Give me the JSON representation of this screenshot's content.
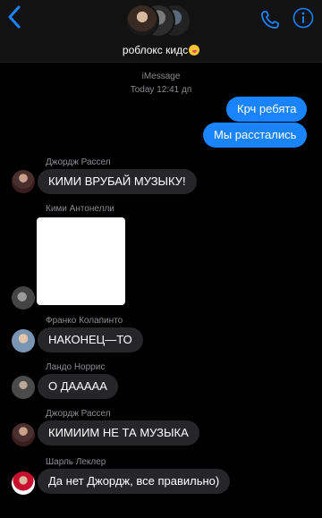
{
  "header": {
    "title": "роблокс кидс",
    "emoji": "grinning-tongue-emoji",
    "icons": [
      "chevron-left-icon",
      "phone-icon",
      "info-icon"
    ],
    "accent": "#1a84ff"
  },
  "thread": {
    "service": "iMessage",
    "timestamp": "Today 12:41 дп"
  },
  "messages": [
    {
      "direction": "out",
      "text": "Крч ребята"
    },
    {
      "direction": "out",
      "text": "Мы расстались"
    },
    {
      "direction": "in",
      "sender": "Джордж Рассел",
      "text": "КИМИ ВРУБАЙ МУЗЫКУ!"
    },
    {
      "direction": "in",
      "sender": "Кими Антонелли",
      "attachment": "image"
    },
    {
      "direction": "in",
      "sender": "Франко Колапинто",
      "text": "НАКОНЕЦ—ТО"
    },
    {
      "direction": "in",
      "sender": "Ландо Норрис",
      "text": "О ДААААА"
    },
    {
      "direction": "in",
      "sender": "Джордж Рассел",
      "text": "КИМИИМ НЕ ТА МУЗЫКА"
    },
    {
      "direction": "in",
      "sender": "Шарль Леклер",
      "text": "Да нет Джордж, все правильно)"
    }
  ]
}
